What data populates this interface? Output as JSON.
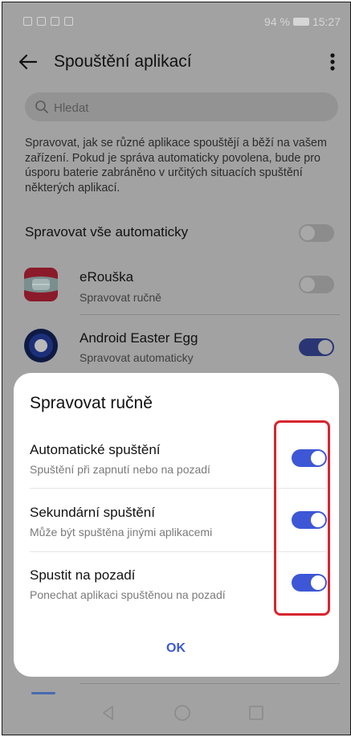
{
  "status_bar": {
    "battery_text": "94 %",
    "time": "15:27"
  },
  "app_bar": {
    "title": "Spouštění aplikací",
    "back_icon": "arrow-left-icon",
    "more_icon": "more-vertical-icon"
  },
  "search": {
    "placeholder": "Hledat"
  },
  "description": "Spravovat, jak se různé aplikace spouštějí a běží na vašem zařízení. Pokud je správa automaticky povolena, bude pro úsporu baterie zabráněno v určitých situacích spuštění některých aplikací.",
  "manage_all": {
    "label": "Spravovat vše automaticky",
    "toggle_on": false
  },
  "apps": [
    {
      "name": "eRouška",
      "status": "Spravovat ručně",
      "toggle_on": false,
      "icon": "erouska-app-icon"
    },
    {
      "name": "Android Easter Egg",
      "status": "Spravovat automaticky",
      "toggle_on": true,
      "icon": "android-easter-egg-app-icon"
    }
  ],
  "dialog": {
    "title": "Spravovat ručně",
    "options": [
      {
        "label": "Automatické spuštění",
        "description": "Spuštění při zapnutí nebo na pozadí",
        "toggle_on": true
      },
      {
        "label": "Sekundární spuštění",
        "description": "Může být spuštěna jinými aplikacemi",
        "toggle_on": true
      },
      {
        "label": "Spustit na pozadí",
        "description": "Ponechat aplikaci spuštěnou na pozadí",
        "toggle_on": true
      }
    ],
    "ok_label": "OK"
  },
  "colors": {
    "accent": "#3d57d6",
    "highlight": "#d8252e"
  }
}
